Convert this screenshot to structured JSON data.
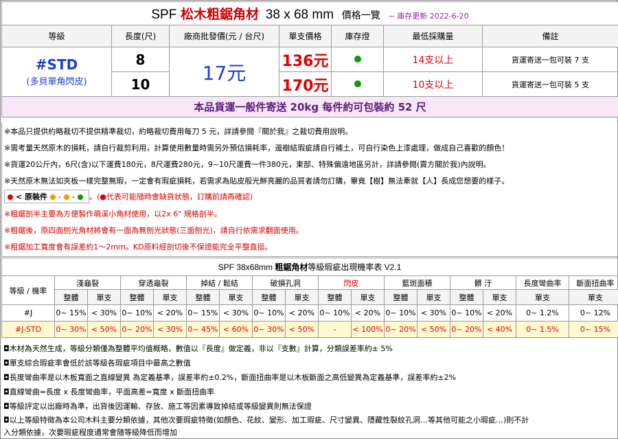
{
  "title": {
    "spf": "SPF",
    "product": "松木粗鋸角材",
    "dimension": "38 x 68 mm",
    "suffix": "價格一覽",
    "updated": "~ 庫存更新 2022-6-20"
  },
  "price_table": {
    "headers": [
      "等級",
      "長度(尺)",
      "廠商批發價(元 / 台尺)",
      "單支價格",
      "庫存燈",
      "最低採購量",
      "備註"
    ],
    "grade_code": "#STD",
    "grade_desc": "(多貝單角閃皮)",
    "wholesale": "17元",
    "rows": [
      {
        "length": "8",
        "price": "136元",
        "stock_color": "#0a9a0a",
        "min_buy": "14支以上",
        "note": "貨運寄送一包可裝 7 支"
      },
      {
        "length": "10",
        "price": "170元",
        "stock_color": "#0a9a0a",
        "min_buy": "10支以上",
        "note": "貨運寄送一包可裝 5 支"
      }
    ],
    "shipping": "本品貨運一般件寄送 20kg 每件約可包裝約 52 尺"
  },
  "notes": [
    "※本品只提供約略裁切不提供精準裁切，約略裁切費用每刀 5 元，詳請參閱『關於我』之裁切費用說明。",
    "※需考量天然原木的損耗，請自行裁剪利用，計算使用數量時需另外預估損耗率，邊樹結瑕疵請自行補土，可自行染色上漆處理，做成自己喜歡的顏色！",
    "※貨運20公斤內，6尺(含)以下運費180元，8尺運費280元，9~10尺運費一件380元，東部、特殊偏遠地區另計，詳請參閱(賣方關於我)內說明。",
    "※天然原木無法如夾板一樣完整無瑕，一定會有瑕疵損耗，若需求為貼皮般光鮮亮麗的品質者請勿訂購，畢竟【樹】無法牽就【人】長成您想要的樣子。"
  ],
  "legend": {
    "label": "< 原裝件",
    "dot_colors": [
      "#e00000",
      "#f0a000",
      "#f0a000",
      "#0a9a0a"
    ],
    "text": "。(●代表可能隨時會缺貨狀態，訂購前請再確認)"
  },
  "warnings": [
    "※粗鋸剖半主要為方便製作萌溪小角材使用，以2x 6\" 規格剖半。",
    "※粗鋸後，原四面刨光角材將會有一面為無刨光狀態(三面刨光)，請自行依需求翻面使用。",
    "※粗鋸加工寬度會有誤差約1～2mｍ。KD原料經剖切後不保證能完全平整直挺。"
  ],
  "defect_table": {
    "title_prefix": "SPF 38x68mm",
    "title_bold": "粗鋸角材",
    "title_suffix": "等級瑕疵出現機率表 V2.1",
    "row_header": "等級 / 機率",
    "categories": [
      {
        "name": "淺龜裂",
        "red": false
      },
      {
        "name": "穿透龜裂",
        "red": false
      },
      {
        "name": "掉結 / 鬆結",
        "red": false
      },
      {
        "name": "破損孔洞",
        "red": false
      },
      {
        "name": "閃皮",
        "red": true
      },
      {
        "name": "藍斑面積",
        "red": false
      },
      {
        "name": "髒 汙",
        "red": false
      }
    ],
    "sub_whole": "整體",
    "sub_single": "單支",
    "extra_headers": [
      "長度彎曲率",
      "斷面扭曲率"
    ],
    "rows": [
      {
        "grade": "#J",
        "cells": [
          "0~ 15%",
          "< 30%",
          "0~ 10%",
          "< 20%",
          "0~ 15%",
          "< 30%",
          "0~ 10%",
          "< 20%",
          "0~ 10%",
          "< 20%",
          "0~ 10%",
          "< 30%",
          "0~ 10%",
          "< 20%"
        ],
        "bend": "0~ 1.2%",
        "twist": "0~ 12%"
      },
      {
        "grade": "#J-STD",
        "cells": [
          "0~ 30%",
          "< 50%",
          "0~ 20%",
          "< 30%",
          "0~ 45%",
          "< 60%",
          "0~ 30%",
          "< 50%",
          "-",
          "< 100%",
          "0~ 20%",
          "< 50%",
          "0~ 20%",
          "< 40%"
        ],
        "bend": "0~ 1.5%",
        "twist": "0~ 15%"
      }
    ]
  },
  "footer_notes": [
    "◘木材為天然生成，等級分類僅為整體平均值概略，數值以『長度』做定義，非以『支數』計算，分類誤差率約± 5%",
    "◘單支綜合瑕疵率會低於該等級各瑕疵項目中最高之數值",
    "◘長度彎曲率是以木板寬面之直線變異 為定義基準，誤差率約±0.2%，斷面扭曲率是以木板斷面之高低變異為定義基準，誤差率約±2%",
    "◘直線彎曲=長度 x 長度彎曲率，平面高差=寬度 x 斷面扭曲率",
    "◘等級評定以出廠時為準，出貨後因運輸、存放、施工等因素導致掉結或等級變異則無法保證",
    "◘以上等級特徵為本公司木料主要分類依據，其他次要瑕疵特徵(如顏色、花紋、變形、加工瑕疵、尺寸變異、隱藏性裂紋孔洞…等其他可能之小瑕疵…)則不計",
    "入分類依據，次要瑕疵程度通常會隨等級降低而增加"
  ]
}
